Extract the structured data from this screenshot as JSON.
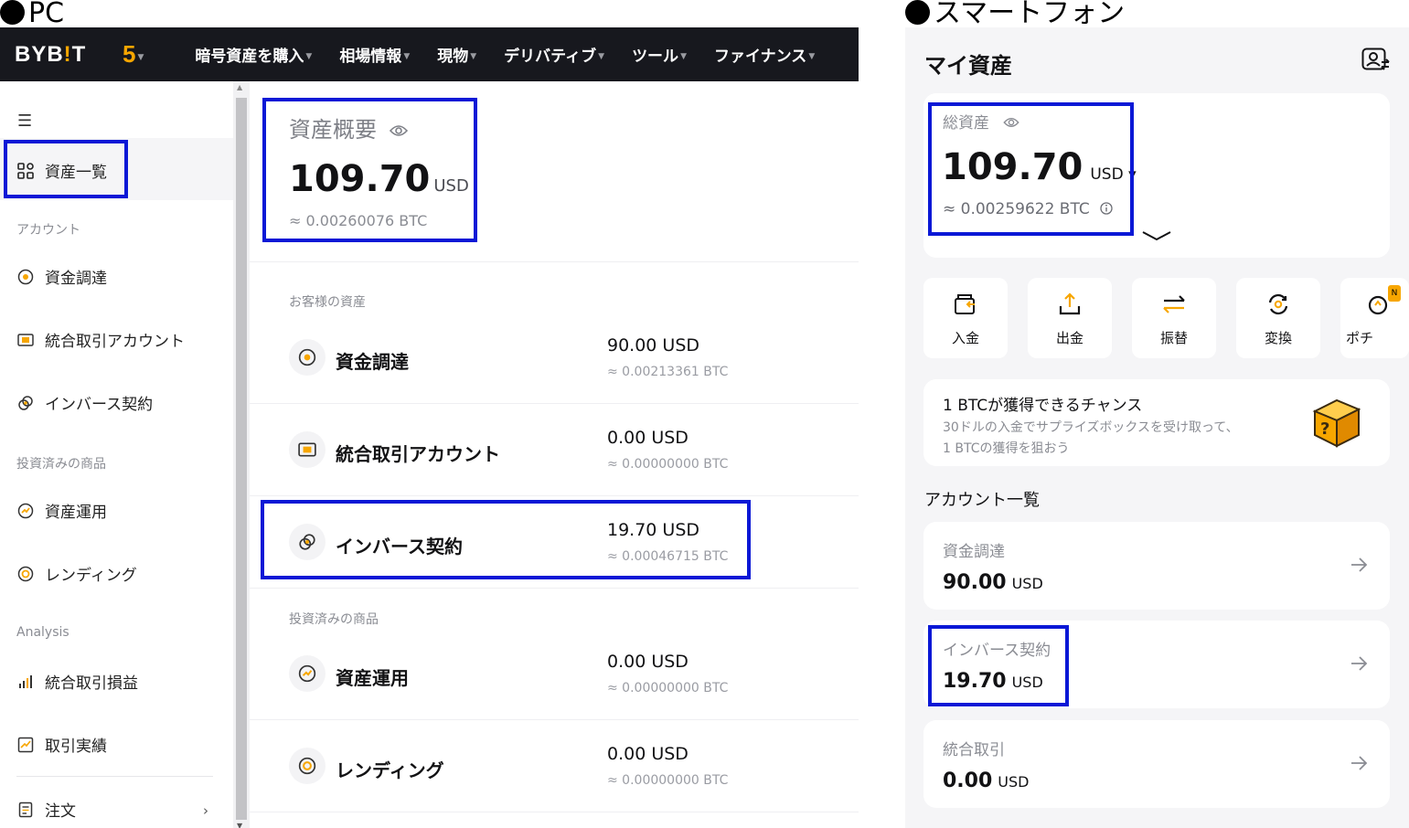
{
  "labels": {
    "pc": "PC",
    "smartphone": "スマートフォン"
  },
  "pc": {
    "logo_main": "BYB",
    "logo_accent": "!",
    "logo_end": "T",
    "logo_five": "5",
    "nav": [
      {
        "label": "暗号資産を購入"
      },
      {
        "label": "相場情報"
      },
      {
        "label": "現物"
      },
      {
        "label": "デリバティブ"
      },
      {
        "label": "ツール"
      },
      {
        "label": "ファイナンス"
      }
    ],
    "sidebar": {
      "active_item": "資産一覧",
      "group_account": "アカウント",
      "item_funding": "資金調達",
      "item_unified": "統合取引アカウント",
      "item_inverse": "インバース契約",
      "group_invested": "投資済みの商品",
      "item_earn": "資産運用",
      "item_lending": "レンディング",
      "group_analysis": "Analysis",
      "item_pnl": "統合取引損益",
      "item_history": "取引実績",
      "item_orders": "注文"
    },
    "overview": {
      "title": "資産概要",
      "value": "109.70",
      "unit": "USD",
      "btc": "≈ 0.00260076 BTC"
    },
    "groups": {
      "customer_assets": "お客様の資産",
      "invested": "投資済みの商品"
    },
    "assets": [
      {
        "name": "資金調達",
        "value": "90.00 USD",
        "btc": "≈ 0.00213361 BTC"
      },
      {
        "name": "統合取引アカウント",
        "value": "0.00 USD",
        "btc": "≈ 0.00000000 BTC"
      },
      {
        "name": "インバース契約",
        "value": "19.70 USD",
        "btc": "≈ 0.00046715 BTC"
      },
      {
        "name": "資産運用",
        "value": "0.00 USD",
        "btc": "≈ 0.00000000 BTC"
      },
      {
        "name": "レンディング",
        "value": "0.00 USD",
        "btc": "≈ 0.00000000 BTC"
      }
    ]
  },
  "sp": {
    "title": "マイ資産",
    "total_label": "総資産",
    "total_value": "109.70",
    "total_unit": "USD ▾",
    "total_btc": "≈ 0.00259622 BTC",
    "actions": [
      {
        "label": "入金"
      },
      {
        "label": "出金"
      },
      {
        "label": "振替"
      },
      {
        "label": "変換"
      },
      {
        "label": "ポチ"
      }
    ],
    "new_badge": "N",
    "promo": {
      "title": "1 BTCが獲得できるチャンス",
      "line1": "30ドルの入金でサプライズボックスを受け取って、",
      "line2": "1 BTCの獲得を狙おう"
    },
    "accounts_heading": "アカウント一覧",
    "accounts": [
      {
        "name": "資金調達",
        "value": "90.00",
        "unit": "USD"
      },
      {
        "name": "インバース契約",
        "value": "19.70",
        "unit": "USD"
      },
      {
        "name": "統合取引",
        "value": "0.00",
        "unit": "USD"
      }
    ]
  },
  "colors": {
    "highlight": "#0a18d6",
    "brand": "#f7a600",
    "nav_bg": "#17181e"
  }
}
